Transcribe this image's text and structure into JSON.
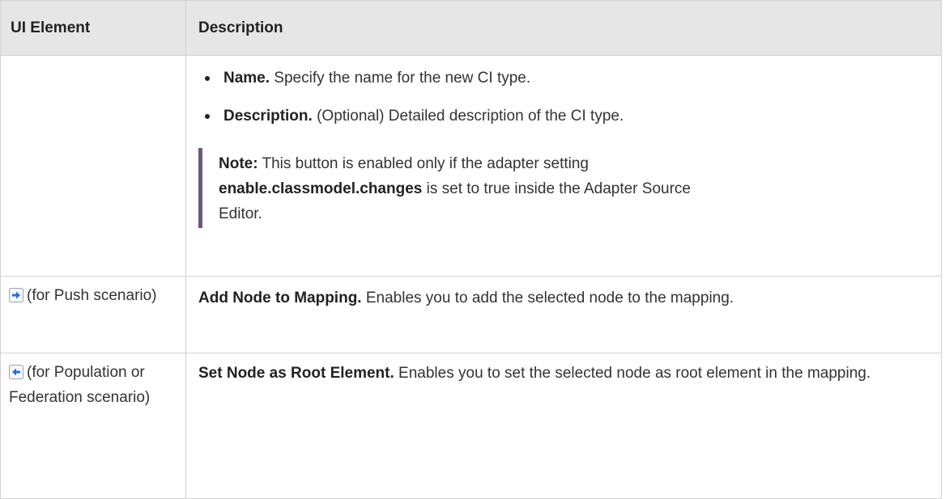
{
  "header": {
    "col_ui": "UI Element",
    "col_desc": "Description"
  },
  "row1": {
    "bullets": [
      {
        "bold": "Name.",
        "text": " Specify the name for the new CI type."
      },
      {
        "bold": "Description.",
        "text": " (Optional) Detailed description of the CI type."
      }
    ],
    "note": {
      "label": "Note:",
      "text1": " This button is enabled only if the adapter setting ",
      "setting": "enable.classmodel.changes",
      "text2": " is set to true inside the Adapter Source Editor."
    }
  },
  "row2": {
    "icon": "arrow-right-icon",
    "ui_text": "(for Push scenario)",
    "desc_bold": "Add Node to Mapping.",
    "desc_text": " Enables you to add the selected node to the mapping."
  },
  "row3": {
    "icon": "arrow-left-icon",
    "ui_text": "(for Population or Federation scenario)",
    "desc_bold": "Set Node as Root Element.",
    "desc_text": " Enables you to set the selected node as root element in the mapping."
  },
  "colors": {
    "header_bg": "#e6e6e6",
    "border": "#d2d2d2",
    "note_bar": "#6b5b78",
    "icon_blue": "#2b6fd6"
  }
}
